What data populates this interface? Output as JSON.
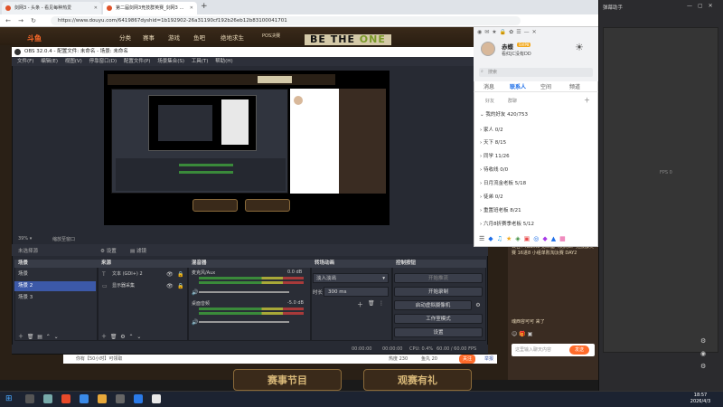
{
  "browser": {
    "tabs": [
      {
        "label": "剑网3 - 头条 - 看见每种热爱",
        "active": false
      },
      {
        "label": "第二届剑网3竞技群英赛_剑网3 …",
        "active": true
      }
    ],
    "new_tab": "+",
    "url": "https://www.douyu.com/6419867dyshid=1b192902-26a31190cf192b26eb12b83100041701"
  },
  "site": {
    "logo": "斗鱼",
    "nav": [
      "分类",
      "赛事",
      "游戏",
      "鱼吧",
      "绝地求生",
      "POS决赛"
    ],
    "banner": {
      "be_the": "BE THE",
      "one": "ONE"
    },
    "bottom_banners": [
      "赛事节目",
      "观赛有礼"
    ],
    "streamer_bar": {
      "text": "你有【50小时】可领取",
      "count1": "热度 230",
      "count2": "鱼丸 20",
      "btn": "关注",
      "report": "举报"
    }
  },
  "obs": {
    "title": "OBS 32.0.4 - 配置文件: 未命名 - 场景: 未命名",
    "menu": [
      "文件(F)",
      "编辑(E)",
      "视图(V)",
      "停靠窗口(D)",
      "配置文件(P)",
      "场景集合(S)",
      "工具(T)",
      "帮助(H)"
    ],
    "zoom": "39%",
    "zoom_label": "缩放至窗口",
    "source_filter_label": "未选择源",
    "props_btn": "设置",
    "filters_btn": "滤镜",
    "panels": {
      "scenes": "场景",
      "sources": "来源",
      "mixer": "混音器",
      "transitions": "转场动画",
      "controls": "控制按钮"
    },
    "scenes": [
      "场景",
      "场景 2",
      "场景 3"
    ],
    "selected_scene": 1,
    "sources": [
      "文本 (GDI+) 2",
      "显示器采集"
    ],
    "mixer": [
      {
        "name": "麦克风/Aux",
        "db": "0.0 dB"
      },
      {
        "name": "桌面音频",
        "db": "-5.0 dB"
      }
    ],
    "transition": {
      "type": "淡入淡出",
      "duration_label": "时长",
      "duration": "300 ms"
    },
    "controls": [
      "开始推流",
      "开始录制",
      "启动虚拟摄像机",
      "工作室模式",
      "设置"
    ],
    "status": {
      "time": "00:00:00",
      "time2": "00:00:00",
      "cpu": "CPU: 0.4%",
      "fps": "60.00 / 60.00 FPS"
    }
  },
  "qq": {
    "username": "赤蝶",
    "status_badge": "SVIP8",
    "signature": "看红JC没有DD",
    "search_placeholder": "搜索",
    "tabs": [
      "消息",
      "联系人",
      "空间",
      "频道"
    ],
    "active_tab": 1,
    "subtabs": [
      "好友",
      "群聊"
    ],
    "groups": [
      {
        "name": "我的好友",
        "count": "420/753"
      },
      {
        "name": "家人",
        "count": "0/2"
      },
      {
        "name": "天下",
        "count": "8/15"
      },
      {
        "name": "同学",
        "count": "11/26"
      },
      {
        "name": "待收线",
        "count": "0/0"
      },
      {
        "name": "日月流金老板",
        "count": "5/18"
      },
      {
        "name": "徒弟",
        "count": "0/2"
      },
      {
        "name": "重置班老板",
        "count": "8/21"
      },
      {
        "name": "六月8折赛季老板",
        "count": "5/12"
      }
    ]
  },
  "chat": {
    "messages": [
      "公告：iGame 第二届《剑网3》竞技群英赛 16进8 小组单败淘汰赛 DAY2"
    ],
    "user_msg": "魂西容可可 来了",
    "input_placeholder": "这里输入聊天内容",
    "send": "发送"
  },
  "notif": {
    "title": "弹幕助手",
    "fps": "FPS 0"
  },
  "taskbar": {
    "time": "18:57",
    "date": "2026/4/3"
  },
  "colors": {
    "accent": "#3c59a8",
    "send": "#ff6b2a",
    "qq_blue": "#1d6ee8"
  }
}
